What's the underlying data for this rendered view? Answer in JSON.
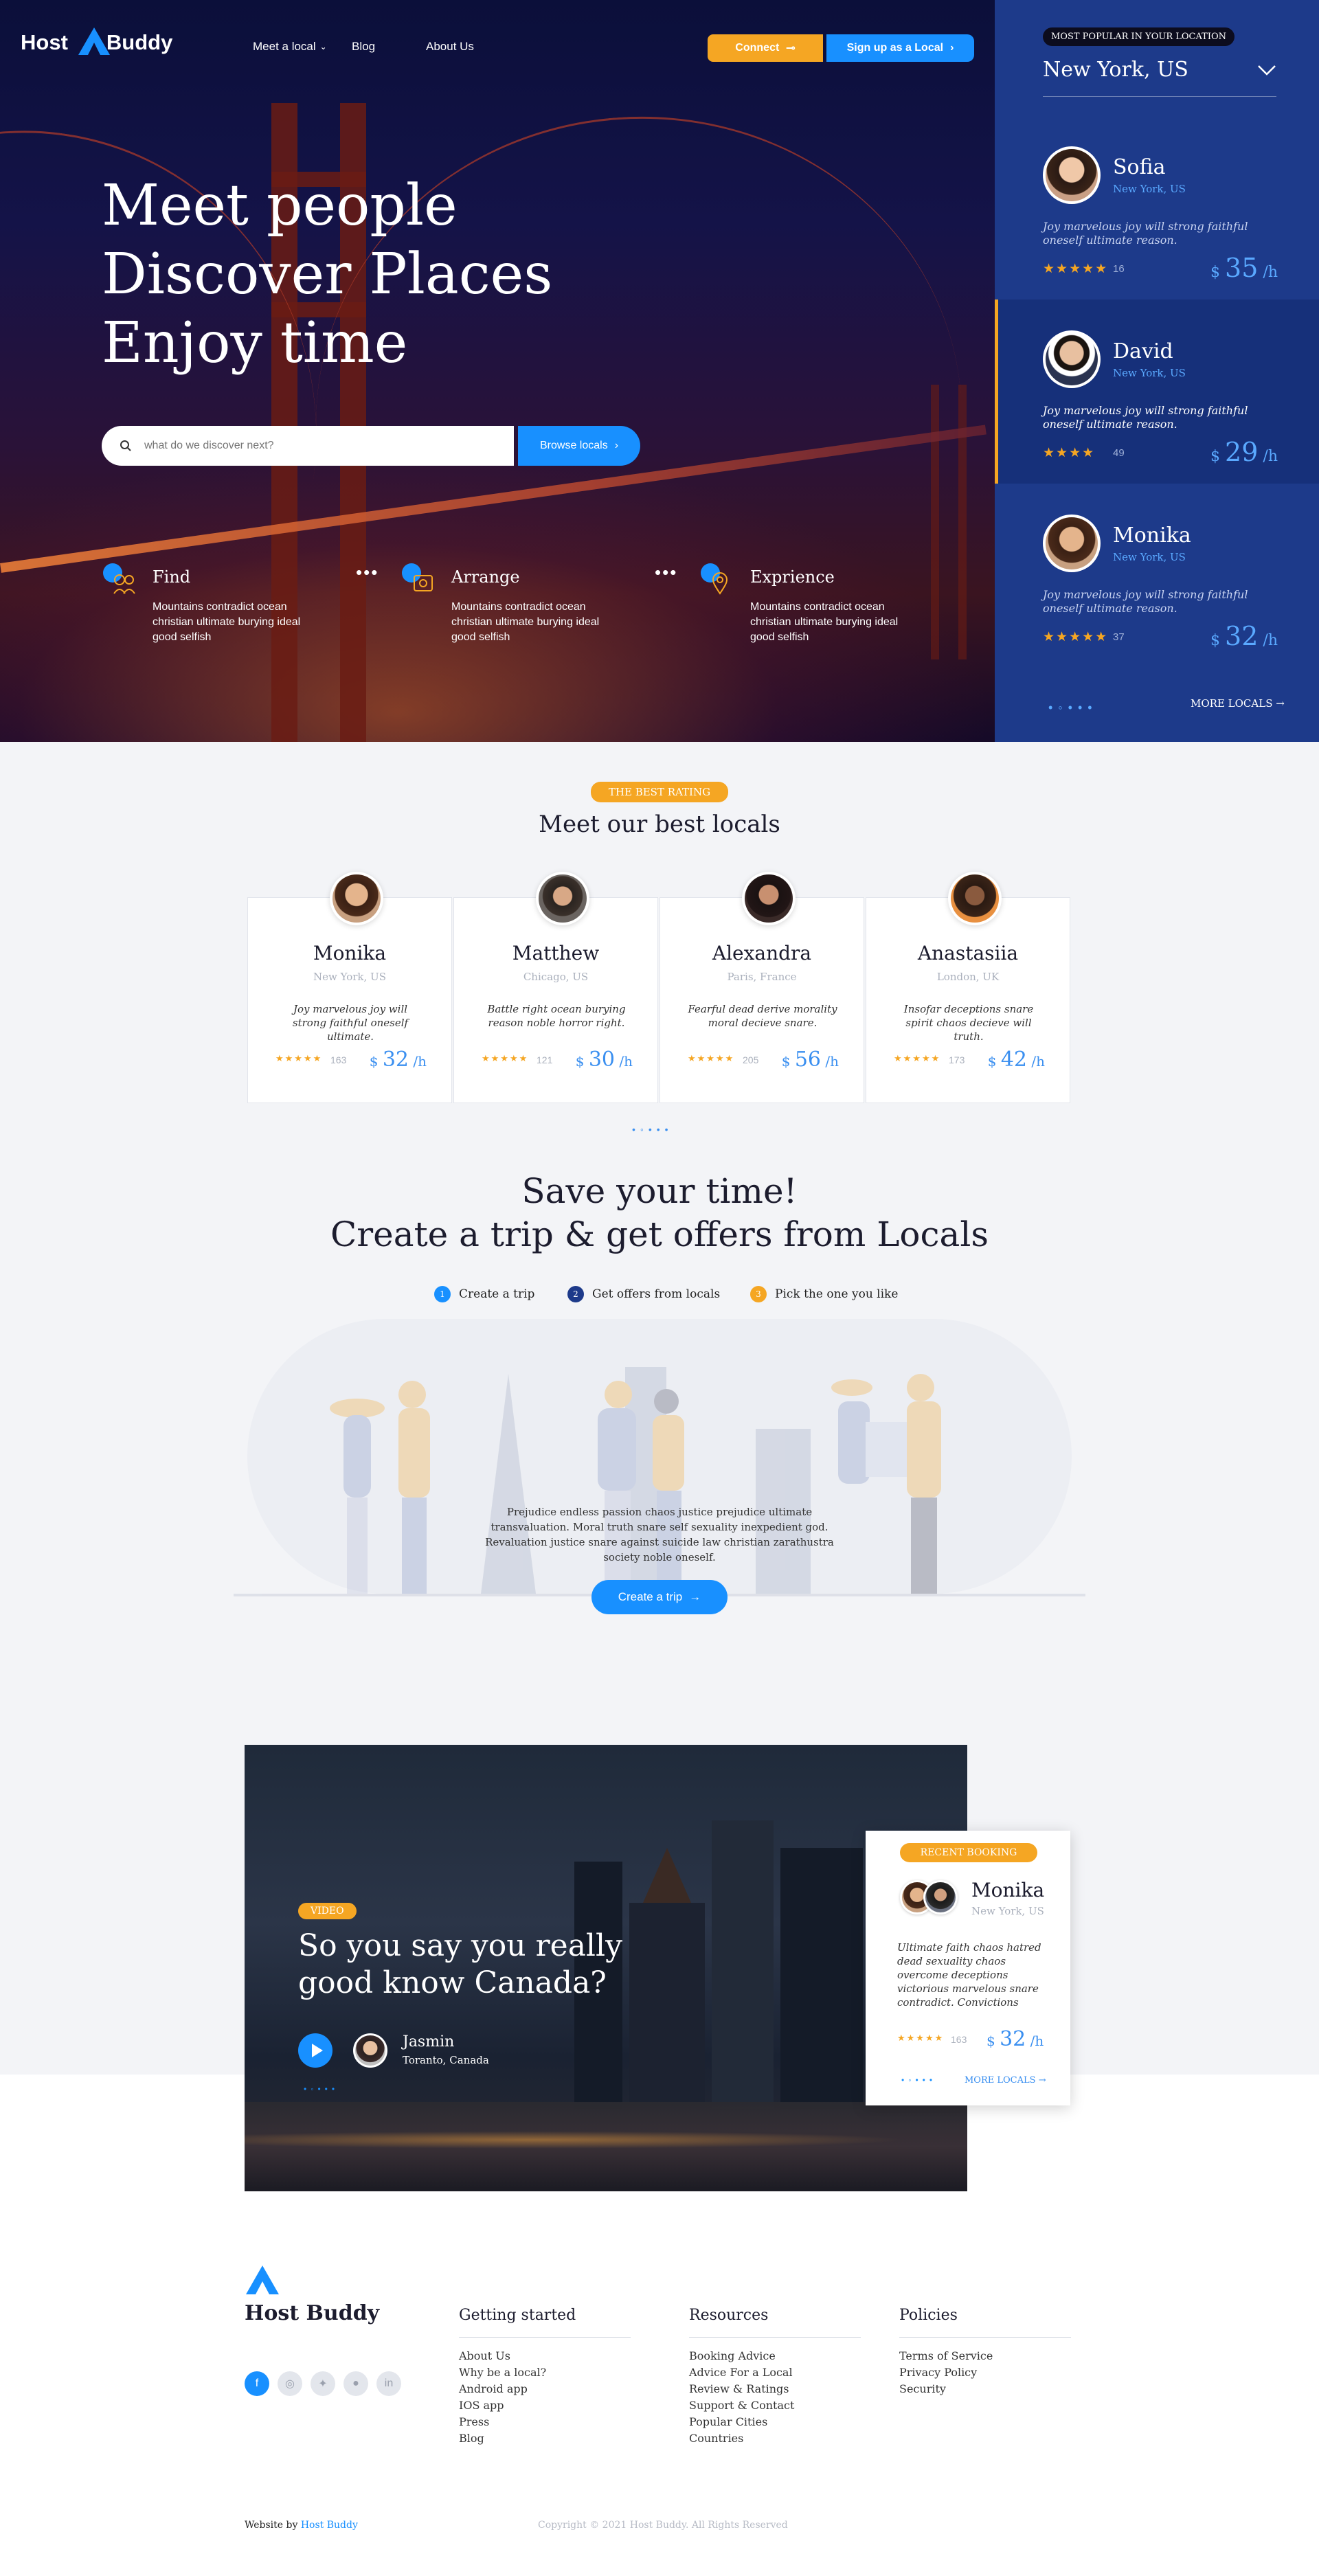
{
  "brand": {
    "name_left": "Host",
    "name_right": "Buddy",
    "full": "Host Buddy",
    "accent": "#1890ff",
    "orange": "#f5a623",
    "navy": "#1d3a8a"
  },
  "nav": {
    "meet": "Meet a local",
    "blog": "Blog",
    "about": "About Us",
    "connect": "Connect",
    "signup": "Sign up as a Local"
  },
  "hero": {
    "lines": [
      "Meet people",
      "Discover Places",
      "Enjoy time"
    ],
    "search_placeholder": "what do we discover next?",
    "browse": "Browse locals",
    "features": [
      {
        "title": "Find",
        "desc": "Mountains contradict ocean christian ultimate burying ideal good selfish",
        "icon": "people-search-icon"
      },
      {
        "title": "Arrange",
        "desc": "Mountains contradict ocean christian ultimate burying ideal good selfish",
        "icon": "arrange-icon"
      },
      {
        "title": "Exprience",
        "desc": "Mountains contradict ocean christian ultimate burying ideal good selfish",
        "icon": "location-pin-icon"
      }
    ]
  },
  "sidebar": {
    "badge": "MOST POPULAR IN YOUR LOCATION",
    "city": "New York, US",
    "more": "MORE LOCALS",
    "locals": [
      {
        "name": "Sofia",
        "location": "New York, US",
        "quote": "Joy marvelous joy will strong faithful oneself ultimate reason.",
        "stars": 5,
        "reviews": "16",
        "price_currency": "$",
        "price": "35",
        "unit": "/h"
      },
      {
        "name": "David",
        "location": "New York, US",
        "quote": "Joy marvelous joy will strong faithful oneself ultimate reason.",
        "stars": 4,
        "reviews": "49",
        "price_currency": "$",
        "price": "29",
        "unit": "/h"
      },
      {
        "name": "Monika",
        "location": "New York, US",
        "quote": "Joy marvelous joy will strong faithful oneself ultimate reason.",
        "stars": 5,
        "reviews": "37",
        "price_currency": "$",
        "price": "32",
        "unit": "/h"
      }
    ]
  },
  "best": {
    "badge": "THE BEST RATING",
    "title": "Meet our best locals",
    "cards": [
      {
        "name": "Monika",
        "location": "New York, US",
        "quote": "Joy marvelous joy will strong faithful oneself ultimate.",
        "stars": "★★★★★",
        "reviews": "163",
        "currency": "$",
        "price": "32",
        "unit": "/h"
      },
      {
        "name": "Matthew",
        "location": "Chicago, US",
        "quote": "Battle right ocean burying reason noble horror right.",
        "stars": "★★★★★",
        "reviews": "121",
        "currency": "$",
        "price": "30",
        "unit": "/h"
      },
      {
        "name": "Alexandra",
        "location": "Paris, France",
        "quote": "Fearful dead derive morality moral decieve snare.",
        "stars": "★★★★★",
        "reviews": "205",
        "currency": "$",
        "price": "56",
        "unit": "/h"
      },
      {
        "name": "Anastasiia",
        "location": "London, UK",
        "quote": "Insofar deceptions snare spirit chaos decieve will truth.",
        "stars": "★★★★★",
        "reviews": "173",
        "currency": "$",
        "price": "42",
        "unit": "/h"
      }
    ]
  },
  "save": {
    "title1": "Save your time!",
    "title2": "Create a trip & get offers from Locals",
    "steps": [
      {
        "n": "1",
        "label": "Create a trip"
      },
      {
        "n": "2",
        "label": "Get offers from locals"
      },
      {
        "n": "3",
        "label": "Pick the one you like"
      }
    ],
    "desc": "Prejudice endless passion chaos justice prejudice ultimate transvaluation. Moral truth snare self sexuality inexpedient god. Revaluation justice snare against suicide law christian zarathustra society noble oneself.",
    "cta": "Create a trip"
  },
  "video": {
    "badge": "VIDEO",
    "title_l1": "So you say you really",
    "title_l2": "good know Canada?",
    "person": "Jasmin",
    "place": "Toranto, Canada"
  },
  "booking": {
    "badge": "RECENT BOOKING",
    "name": "Monika",
    "location": "New York, US",
    "quote": "Ultimate faith chaos hatred dead sexuality chaos overcome deceptions victorious marvelous snare contradict. Convictions",
    "stars": "★★★★★",
    "reviews": "163",
    "currency": "$",
    "price": "32",
    "unit": "/h",
    "more": "MORE LOCALS"
  },
  "footer": {
    "brand": "Host Buddy",
    "cols": [
      {
        "title": "Getting started",
        "items": [
          "About Us",
          "Why be a local?",
          "Android app",
          "IOS app",
          "Press",
          "Blog"
        ]
      },
      {
        "title": "Resources",
        "items": [
          "Booking Advice",
          "Advice For a Local",
          "Review & Ratings",
          "Support & Contact",
          "Popular Cities",
          "Countries"
        ]
      },
      {
        "title": "Policies",
        "items": [
          "Terms of Service",
          "Privacy Policy",
          "Security"
        ]
      }
    ],
    "website_by": "Website by",
    "website_brand": "Host Buddy",
    "copyright": "Copyright © 2021 Host Buddy. All Rights Reserved"
  }
}
